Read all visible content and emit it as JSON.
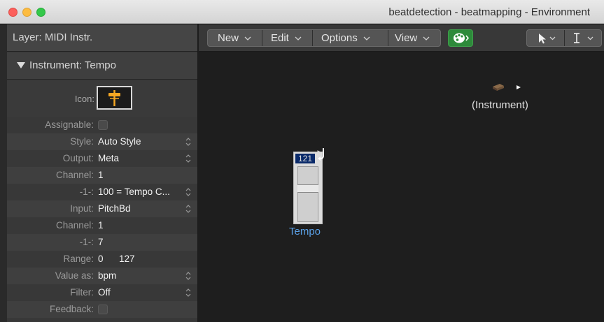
{
  "window": {
    "title": "beatdetection - beatmapping - Environment"
  },
  "inspector": {
    "layer_label": "Layer: MIDI Instr.",
    "instrument_label": "Instrument: Tempo",
    "icon_label": "Icon:",
    "rows": [
      {
        "label": "Assignable:",
        "checkbox": true
      },
      {
        "label": "Style:",
        "value": "Auto Style",
        "menu": true
      },
      {
        "label": "Output:",
        "value": "Meta",
        "menu": true
      },
      {
        "label": "Channel:",
        "value": "1"
      },
      {
        "label": "-1-:",
        "value": "100 = Tempo C...",
        "menu": true
      },
      {
        "label": "Input:",
        "value": "PitchBd",
        "menu": true
      },
      {
        "label": "Channel:",
        "value": "1"
      },
      {
        "label": "-1-:",
        "value": "7"
      },
      {
        "label": "Range:",
        "value": "0",
        "value2": "127"
      },
      {
        "label": "Value as:",
        "value": "bpm",
        "menu": true
      },
      {
        "label": "Filter:",
        "value": "Off",
        "menu": true
      },
      {
        "label": "Feedback:",
        "checkbox": true
      }
    ]
  },
  "toolbar": {
    "new_label": "New",
    "edit_label": "Edit",
    "options_label": "Options",
    "view_label": "View"
  },
  "canvas": {
    "instrument_object_label": "(Instrument)",
    "fader_value": "121",
    "fader_level": 0.62,
    "fader_name": "Tempo"
  },
  "icons": {
    "traffic_lights": [
      "close-icon",
      "minimize-icon",
      "zoom-icon"
    ],
    "palette": "palette-icon",
    "pointer": "pointer-tool-icon",
    "text": "text-cursor-tool-icon"
  },
  "colors": {
    "accent": "#2d8a3a",
    "fader_label": "#5aa0e6"
  }
}
